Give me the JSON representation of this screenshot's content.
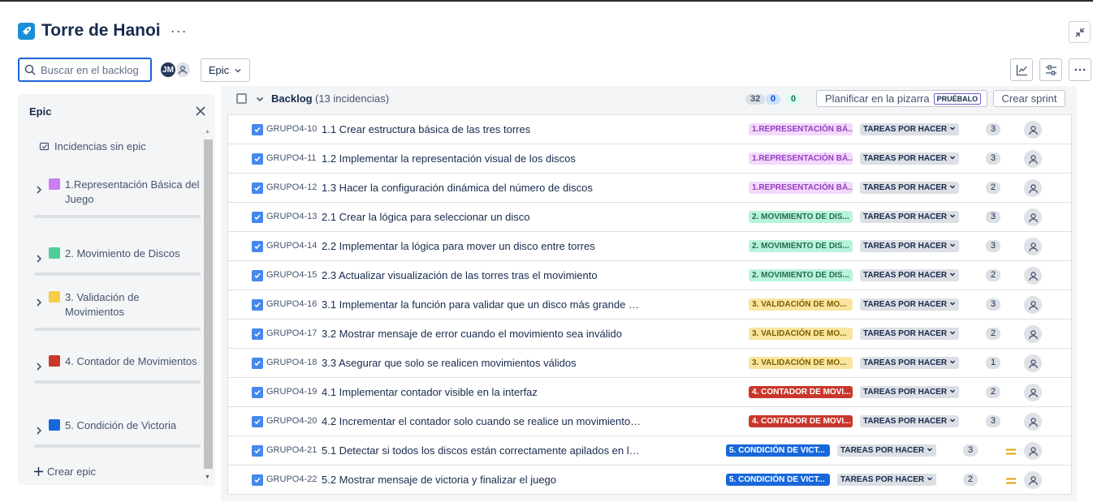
{
  "header": {
    "title": "Torre de Hanoi",
    "more_label": "···"
  },
  "toolbar": {
    "search_placeholder": "Buscar en el backlog",
    "avatar_initials": "JM",
    "epic_filter_label": "Epic"
  },
  "epic_panel": {
    "title": "Epic",
    "no_epic_label": "Incidencias sin epic",
    "items": [
      {
        "label": "1.Representación Básica del Juego",
        "color": "#c97cf4"
      },
      {
        "label": "2. Movimiento de Discos",
        "color": "#4bce97"
      },
      {
        "label": "3. Validación de Movimientos",
        "color": "#f5cd47"
      },
      {
        "label": "4. Contador de Movimientos",
        "color": "#c9372c"
      },
      {
        "label": "5. Condición de Victoria",
        "color": "#1868db"
      }
    ],
    "create_label": "Crear epic"
  },
  "backlog": {
    "title": "Backlog",
    "count_label": "(13 incidencias)",
    "counts": {
      "todo": "32",
      "in_progress": "0",
      "done": "0"
    },
    "plan_label": "Planificar en la pizarra",
    "plan_badge": "PRUÉBALO",
    "create_sprint_label": "Crear sprint",
    "issues": [
      {
        "key": "GRUPO4-10",
        "summary": "1.1 Crear estructura básica de las tres torres",
        "epic": "1.REPRESENTACIÓN BÁ...",
        "epic_idx": 0,
        "status": "TAREAS POR HACER",
        "points": "3",
        "priority": false
      },
      {
        "key": "GRUPO4-11",
        "summary": "1.2 Implementar la representación visual de los discos",
        "epic": "1.REPRESENTACIÓN BÁ...",
        "epic_idx": 0,
        "status": "TAREAS POR HACER",
        "points": "3",
        "priority": false
      },
      {
        "key": "GRUPO4-12",
        "summary": "1.3 Hacer la configuración dinámica del número de discos",
        "epic": "1.REPRESENTACIÓN BÁ...",
        "epic_idx": 0,
        "status": "TAREAS POR HACER",
        "points": "2",
        "priority": false
      },
      {
        "key": "GRUPO4-13",
        "summary": "2.1 Crear la lógica para seleccionar un disco",
        "epic": "2. MOVIMIENTO DE DIS...",
        "epic_idx": 1,
        "status": "TAREAS POR HACER",
        "points": "3",
        "priority": false
      },
      {
        "key": "GRUPO4-14",
        "summary": "2.2 Implementar la lógica para mover un disco entre torres",
        "epic": "2. MOVIMIENTO DE DIS...",
        "epic_idx": 1,
        "status": "TAREAS POR HACER",
        "points": "3",
        "priority": false
      },
      {
        "key": "GRUPO4-15",
        "summary": "2.3 Actualizar visualización de las torres tras el movimiento",
        "epic": "2. MOVIMIENTO DE DIS...",
        "epic_idx": 1,
        "status": "TAREAS POR HACER",
        "points": "2",
        "priority": false
      },
      {
        "key": "GRUPO4-16",
        "summary": "3.1 Implementar la función para validar que un disco más grande no se mueva sobre uno ...",
        "epic": "3. VALIDACIÓN DE MO...",
        "epic_idx": 2,
        "status": "TAREAS POR HACER",
        "points": "3",
        "priority": false
      },
      {
        "key": "GRUPO4-17",
        "summary": "3.2 Mostrar mensaje de error cuando el movimiento sea inválido",
        "epic": "3. VALIDACIÓN DE MO...",
        "epic_idx": 2,
        "status": "TAREAS POR HACER",
        "points": "2",
        "priority": false
      },
      {
        "key": "GRUPO4-18",
        "summary": "3.3 Asegurar que solo se realicen movimientos válidos",
        "epic": "3. VALIDACIÓN DE MO...",
        "epic_idx": 2,
        "status": "TAREAS POR HACER",
        "points": "1",
        "priority": false
      },
      {
        "key": "GRUPO4-19",
        "summary": "4.1 Implementar contador visible en la interfaz",
        "epic": "4. CONTADOR DE MOVI...",
        "epic_idx": 3,
        "status": "TAREAS POR HACER",
        "points": "2",
        "priority": false
      },
      {
        "key": "GRUPO4-20",
        "summary": "4.2 Incrementar el contador solo cuando se realice un movimiento válido",
        "epic": "4. CONTADOR DE MOVI...",
        "epic_idx": 3,
        "status": "TAREAS POR HACER",
        "points": "3",
        "priority": false
      },
      {
        "key": "GRUPO4-21",
        "summary": "5.1 Detectar si todos los discos están correctamente apilados en la última torre",
        "epic": "5. CONDICIÓN DE VICT...",
        "epic_idx": 4,
        "status": "TAREAS POR HACER",
        "points": "3",
        "priority": true
      },
      {
        "key": "GRUPO4-22",
        "summary": "5.2 Mostrar mensaje de victoria y finalizar el juego",
        "epic": "5. CONDICIÓN DE VICT...",
        "epic_idx": 4,
        "status": "TAREAS POR HACER",
        "points": "2",
        "priority": true
      }
    ]
  },
  "epic_label_styles": [
    {
      "bg": "#f3d9fc",
      "fg": "#943fbf"
    },
    {
      "bg": "#baf3db",
      "fg": "#216e4e"
    },
    {
      "bg": "#f8e6a0",
      "fg": "#7f5f01"
    },
    {
      "bg": "#c9372c",
      "fg": "#ffffff"
    },
    {
      "bg": "#1868db",
      "fg": "#ffffff"
    }
  ],
  "colors": {
    "accent": "#1d63d8",
    "issue_icon": "#4688ec",
    "priority": "#e2a203"
  }
}
